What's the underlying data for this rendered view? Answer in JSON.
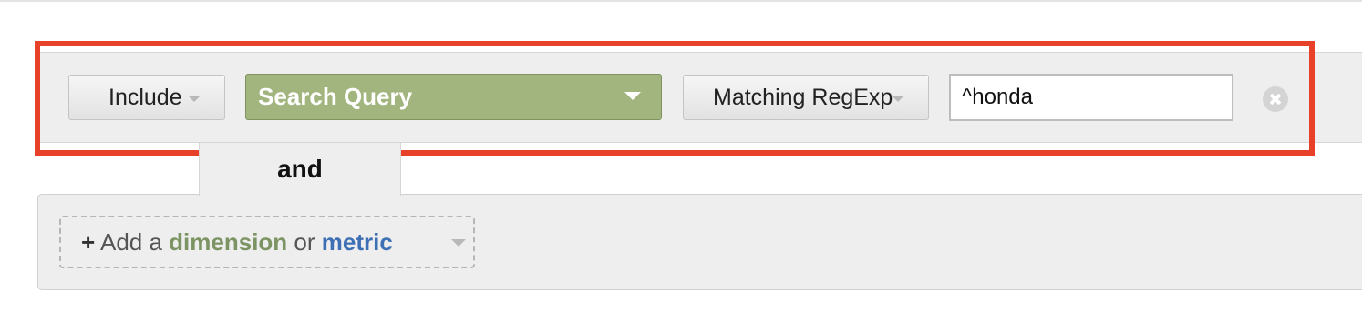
{
  "filter": {
    "include_label": "Include",
    "dimension_label": "Search Query",
    "match_type_label": "Matching RegExp",
    "value": "^honda",
    "remove_icon": "circle-x-icon"
  },
  "connector": {
    "label": "and"
  },
  "add": {
    "plus": "+",
    "prefix": "Add a",
    "dimension_word": "dimension",
    "or_word": "or",
    "metric_word": "metric"
  },
  "colors": {
    "highlight": "#e8412a",
    "dimension_button": "#a2b57e",
    "dimension_text": "#7c9463",
    "metric_text": "#3d6fb4"
  }
}
